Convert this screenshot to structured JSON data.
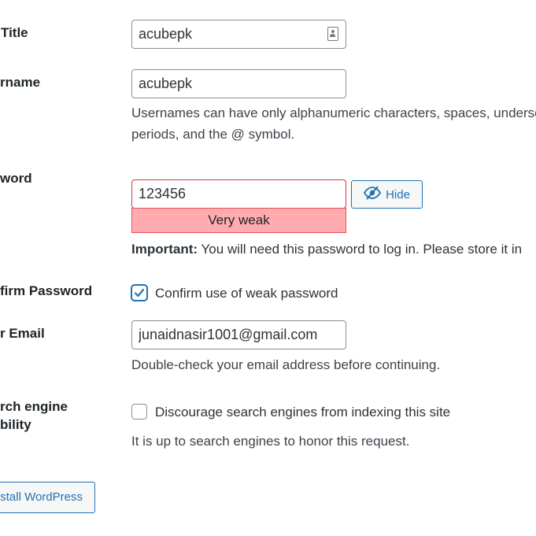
{
  "form": {
    "site_title": {
      "label": "Title",
      "value": "acubepk"
    },
    "username": {
      "label": "rname",
      "value": "acubepk",
      "description_line1": "Usernames can have only alphanumeric characters, spaces, undersc",
      "description_line2": "periods, and the @ symbol."
    },
    "password": {
      "label": "word",
      "value": "123456",
      "hide_label": "Hide",
      "strength": "Very weak",
      "important_label": "Important:",
      "important_text": " You will need this password to log in. Please store it in"
    },
    "confirm_password": {
      "label": "firm Password",
      "checkbox_label": "Confirm use of weak password",
      "checked": true
    },
    "email": {
      "label": "r Email",
      "value": "junaidnasir1001@gmail.com",
      "description": "Double-check your email address before continuing."
    },
    "search_visibility": {
      "label_line1": "rch engine",
      "label_line2": "bility",
      "checkbox_label": "Discourage search engines from indexing this site",
      "checked": false,
      "description": "It is up to search engines to honor this request."
    },
    "install_button": "stall WordPress"
  },
  "colors": {
    "accent": "#2271b1",
    "weak_bg": "#ffabaf",
    "weak_border": "#e65054"
  }
}
